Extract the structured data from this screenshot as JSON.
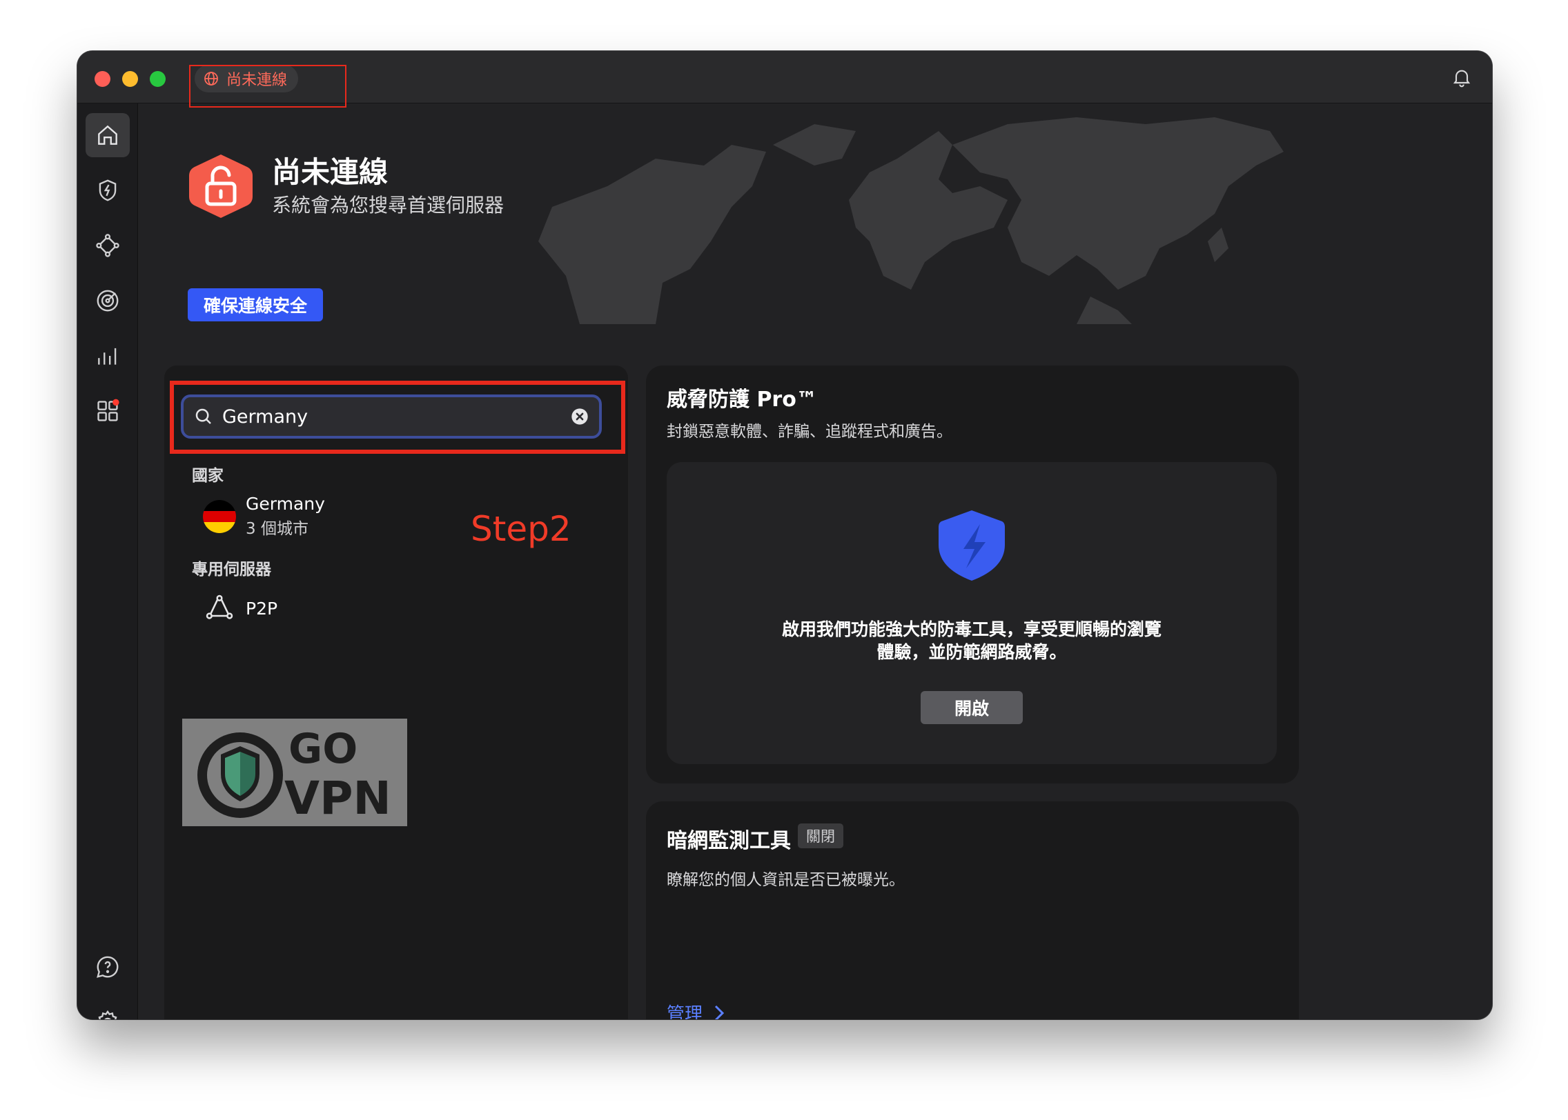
{
  "titlebar": {
    "status_label": "尚未連線"
  },
  "connection": {
    "title": "尚未連線",
    "subtitle": "系統會為您搜尋首選伺服器",
    "secure_button": "確保連線安全"
  },
  "search": {
    "value": "Germany",
    "placeholder": ""
  },
  "results": {
    "countries_label": "國家",
    "countries": [
      {
        "name": "Germany",
        "detail": "3 個城市"
      }
    ],
    "specialty_label": "專用伺服器",
    "specialty": [
      {
        "name": "P2P"
      }
    ]
  },
  "annotation": {
    "step_label": "Step2"
  },
  "logo": {
    "line1": "GO",
    "line2": "VPN"
  },
  "threat_protection": {
    "title": "威脅防護 Pro™",
    "subtitle": "封鎖惡意軟體、詐騙、追蹤程式和廣告。",
    "description_line1": "啟用我們功能強大的防毒工具，享受更順暢的瀏覽",
    "description_line2": "體驗，並防範網路威脅。",
    "enable_button": "開啟"
  },
  "dark_web": {
    "title": "暗網監測工具",
    "status_badge": "關閉",
    "subtitle": "瞭解您的個人資訊是否已被曝光。",
    "manage_link": "管理"
  },
  "colors": {
    "accent_blue": "#3458f5",
    "disconnected_red": "#ff6a5a",
    "annotation_red": "#e8291c",
    "shield_blue": "#3a5cf0"
  }
}
